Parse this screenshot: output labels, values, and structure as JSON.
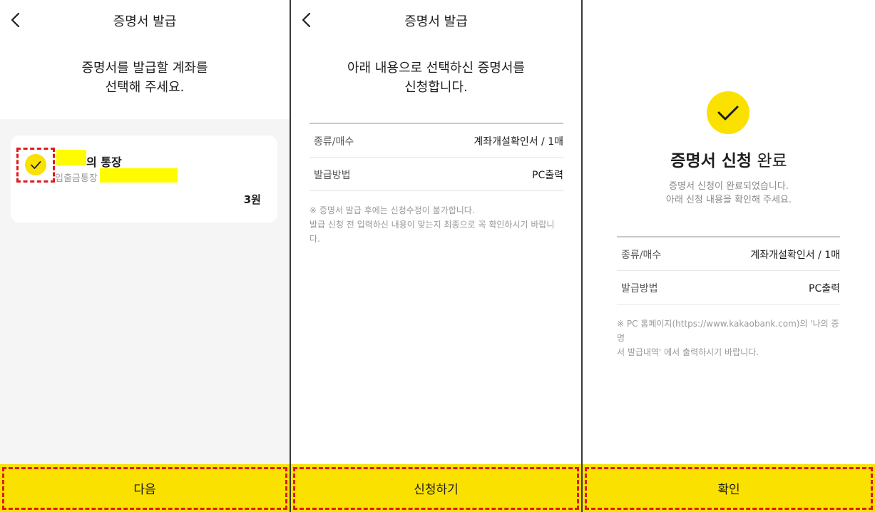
{
  "colors": {
    "accent_yellow": "#fae100",
    "highlight": "#fffc00",
    "annotation_red": "#e0191b"
  },
  "panel1": {
    "header_title": "증명서 발급",
    "back_icon": "chevron-left-icon",
    "headline_line1": "증명서를 발급할 계좌를",
    "headline_line2": "선택해 주세요.",
    "account": {
      "name_suffix": "의 통장",
      "type": "입출금통장",
      "balance": "3원",
      "selected": true,
      "check_icon": "check-icon"
    },
    "button_label": "다음"
  },
  "panel2": {
    "header_title": "증명서 발급",
    "back_icon": "chevron-left-icon",
    "headline_line1": "아래 내용으로 선택하신 증명서를",
    "headline_line2": "신청합니다.",
    "rows": [
      {
        "label": "종류/매수",
        "value": "계좌개설확인서 / 1매"
      },
      {
        "label": "발급방법",
        "value": "PC출력"
      }
    ],
    "notice_line1": "※ 증명서 발급 후에는 신청수정이 불가합니다.",
    "notice_line2": "발급 신청 전 입력하신 내용이 맞는지 최종으로 꼭 확인하시기 바랍니",
    "notice_line3": "다.",
    "button_label": "신청하기"
  },
  "panel3": {
    "check_icon": "check-icon",
    "title_bold": "증명서 신청",
    "title_rest": "완료",
    "desc_line1": "증명서 신청이 완료되었습니다.",
    "desc_line2": "아래 신청 내용을 확인해 주세요.",
    "rows": [
      {
        "label": "종류/매수",
        "value": "계좌개설확인서 / 1매"
      },
      {
        "label": "발급방법",
        "value": "PC출력"
      }
    ],
    "notice_line1": "※ PC 홈페이지(https://www.kakaobank.com)의 '나의 증명",
    "notice_line2": "서 발급내역' 에서 출력하시기 바랍니다.",
    "button_label": "확인"
  }
}
